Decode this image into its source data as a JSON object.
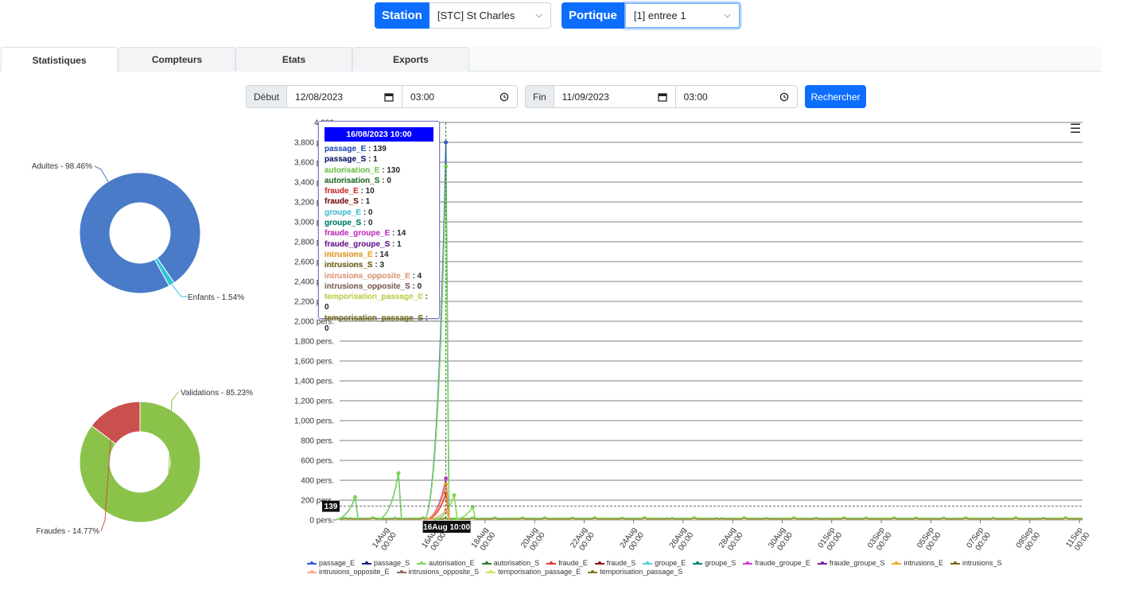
{
  "header": {
    "station_label": "Station",
    "station_value": "[STC] St Charles",
    "portique_label": "Portique",
    "portique_value": "[1] entree 1"
  },
  "tabs": [
    {
      "label": "Statistiques",
      "active": true
    },
    {
      "label": "Compteurs",
      "active": false
    },
    {
      "label": "Etats",
      "active": false
    },
    {
      "label": "Exports",
      "active": false
    }
  ],
  "filters": {
    "start_label": "Début",
    "start_date": "12/08/2023",
    "start_time": "03:00",
    "end_label": "Fin",
    "end_date": "11/09/2023",
    "end_time": "03:00",
    "search_label": "Rechercher"
  },
  "chart_data": [
    {
      "type": "pie",
      "categories": [
        "Adultes",
        "Enfants"
      ],
      "values": [
        98.46,
        1.54
      ],
      "labels": [
        "Adultes - 98.46%",
        "Enfants - 1.54%"
      ],
      "colors": [
        "#4a7bc8",
        "#2fc4d8"
      ]
    },
    {
      "type": "pie",
      "categories": [
        "Validations",
        "Fraudes"
      ],
      "values": [
        85.23,
        14.77
      ],
      "labels": [
        "Validations - 85.23%",
        "Fraudes - 14.77%"
      ],
      "colors": [
        "#8bc34a",
        "#c9504c"
      ]
    },
    {
      "type": "line",
      "ylim": [
        0,
        4000
      ],
      "y_ticks": [
        "0 pers.",
        "200 pers.",
        "400 pers.",
        "600 pers.",
        "800 pers.",
        "1,000 pers.",
        "1,200 pers.",
        "1,400 pers.",
        "1,600 pers.",
        "1,800 pers.",
        "2,000 pers.",
        "2,200 pers.",
        "2,400 pers.",
        "2,600 pers.",
        "2,800 pers.",
        "3,000 pers.",
        "3,200 pers.",
        "3,400 pers.",
        "3,600 pers.",
        "3,800 pers.",
        "4,000"
      ],
      "x_ticks": [
        "14Aug 00:00",
        "16Aug 00:00",
        "18Aug 00:00",
        "20Aug 00:00",
        "22Aug 00:00",
        "24Aug 00:00",
        "26Aug 00:00",
        "28Aug 00:00",
        "30Aug 00:00",
        "01Sep 00:00",
        "03Sep 00:00",
        "05Sep 00:00",
        "07Sep 00:00",
        "09Sep 00:00",
        "11Sep 00:00"
      ],
      "x_range": [
        "2023-08-12 03:00",
        "2023-09-11 03:00"
      ],
      "crosshair_x_label": "16Aug 10:00",
      "crosshair_y_label": "139",
      "crosshair_y_value": 139,
      "series": [
        {
          "name": "passage_E",
          "color": "#2f5bd8",
          "peaks": [
            [
              "2023-08-12 18:00",
              230
            ],
            [
              "2023-08-14 12:00",
              470
            ],
            [
              "2023-08-16 10:00",
              3800
            ]
          ]
        },
        {
          "name": "passage_S",
          "color": "#1a237e",
          "peaks": []
        },
        {
          "name": "autorisation_E",
          "color": "#7ed957",
          "peaks": [
            [
              "2023-08-12 18:00",
              230
            ],
            [
              "2023-08-14 12:00",
              470
            ],
            [
              "2023-08-16 10:00",
              3560
            ],
            [
              "2023-08-16 18:00",
              250
            ],
            [
              "2023-08-17 12:00",
              130
            ]
          ]
        },
        {
          "name": "autorisation_S",
          "color": "#2e7d32",
          "peaks": []
        },
        {
          "name": "fraude_E",
          "color": "#e53935",
          "peaks": [
            [
              "2023-08-16 10:00",
              270
            ]
          ]
        },
        {
          "name": "fraude_S",
          "color": "#8b1a1a",
          "peaks": []
        },
        {
          "name": "groupe_E",
          "color": "#4dd0e1",
          "peaks": []
        },
        {
          "name": "groupe_S",
          "color": "#00897b",
          "peaks": []
        },
        {
          "name": "fraude_groupe_E",
          "color": "#d63bd6",
          "peaks": [
            [
              "2023-08-16 10:00",
              420
            ]
          ]
        },
        {
          "name": "fraude_groupe_S",
          "color": "#7b1fa2",
          "peaks": []
        },
        {
          "name": "intrusions_E",
          "color": "#f5a623",
          "peaks": [
            [
              "2023-08-16 10:00",
              360
            ]
          ]
        },
        {
          "name": "intrusions_S",
          "color": "#7a6a1c",
          "peaks": []
        },
        {
          "name": "intrusions_opposite_E",
          "color": "#f4a98a",
          "peaks": [
            [
              "2023-08-16 10:00",
              100
            ]
          ]
        },
        {
          "name": "intrusions_opposite_S",
          "color": "#8d6e63",
          "peaks": []
        },
        {
          "name": "temporisation_passage_E",
          "color": "#d4e157",
          "peaks": []
        },
        {
          "name": "temporisation_passage_S",
          "color": "#827717",
          "peaks": []
        }
      ]
    }
  ],
  "tooltip": {
    "title": "16/08/2023 10:00",
    "rows": [
      {
        "name": "passage_E",
        "value": "139"
      },
      {
        "name": "passage_S",
        "value": "1"
      },
      {
        "name": "autorisation_E",
        "value": "130"
      },
      {
        "name": "autorisation_S",
        "value": "0"
      },
      {
        "name": "fraude_E",
        "value": "10"
      },
      {
        "name": "fraude_S",
        "value": "1"
      },
      {
        "name": "groupe_E",
        "value": "0"
      },
      {
        "name": "groupe_S",
        "value": "0"
      },
      {
        "name": "fraude_groupe_E",
        "value": "14"
      },
      {
        "name": "fraude_groupe_S",
        "value": "1"
      },
      {
        "name": "intrusions_E",
        "value": "14"
      },
      {
        "name": "intrusions_S",
        "value": "3"
      },
      {
        "name": "intrusions_opposite_E",
        "value": "4"
      },
      {
        "name": "intrusions_opposite_S",
        "value": "0"
      },
      {
        "name": "temporisation_passage_E",
        "value": "0"
      },
      {
        "name": "temporisation_passage_S",
        "value": "0"
      }
    ]
  },
  "icons": {
    "chevron": "chevron-down-icon",
    "calendar": "calendar-icon",
    "clock": "clock-icon",
    "menu": "hamburger-menu-icon"
  }
}
